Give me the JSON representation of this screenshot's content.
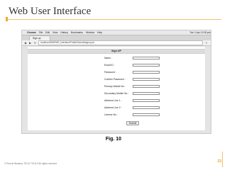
{
  "slide": {
    "title": "Web User Interface",
    "figure_caption": "Fig. 10",
    "footer": "© Ronnie Bhaskar, TECH TOOLS   All rights reserved",
    "page_number": "23"
  },
  "screenshot": {
    "menubar": {
      "apple": "",
      "items": [
        "Chrome",
        "File",
        "Edit",
        "View",
        "History",
        "Bookmarks",
        "Window",
        "Help"
      ],
      "right": "Tue 1 Apr 12:00 pm"
    },
    "tab": {
      "label": "Sign up"
    },
    "toolbar": {
      "back": "◀",
      "forward": "▶",
      "reload": "↻",
      "url": "localhost:8080/WE_Interface/Profile/Submit/signup.jsf",
      "menu": "≡"
    },
    "form": {
      "header": "Sign UP",
      "fields": [
        {
          "label": "Name :",
          "value": ""
        },
        {
          "label": "Email ID :",
          "value": ""
        },
        {
          "label": "Password :",
          "value": ""
        },
        {
          "label": "Confirm Password :",
          "value": ""
        },
        {
          "label": "Primary Mobile No :",
          "value": ""
        },
        {
          "label": "Secondary Mobile No :",
          "value": ""
        },
        {
          "label": "Address Line 1 :",
          "value": ""
        },
        {
          "label": "Address Line 2 :",
          "value": ""
        },
        {
          "label": "License No :",
          "value": ""
        }
      ],
      "submit_label": "Submit"
    }
  },
  "colors": {
    "accent": "#f0a020",
    "rule": "#f0c070",
    "form_header_bg": "#dcdcdc"
  }
}
